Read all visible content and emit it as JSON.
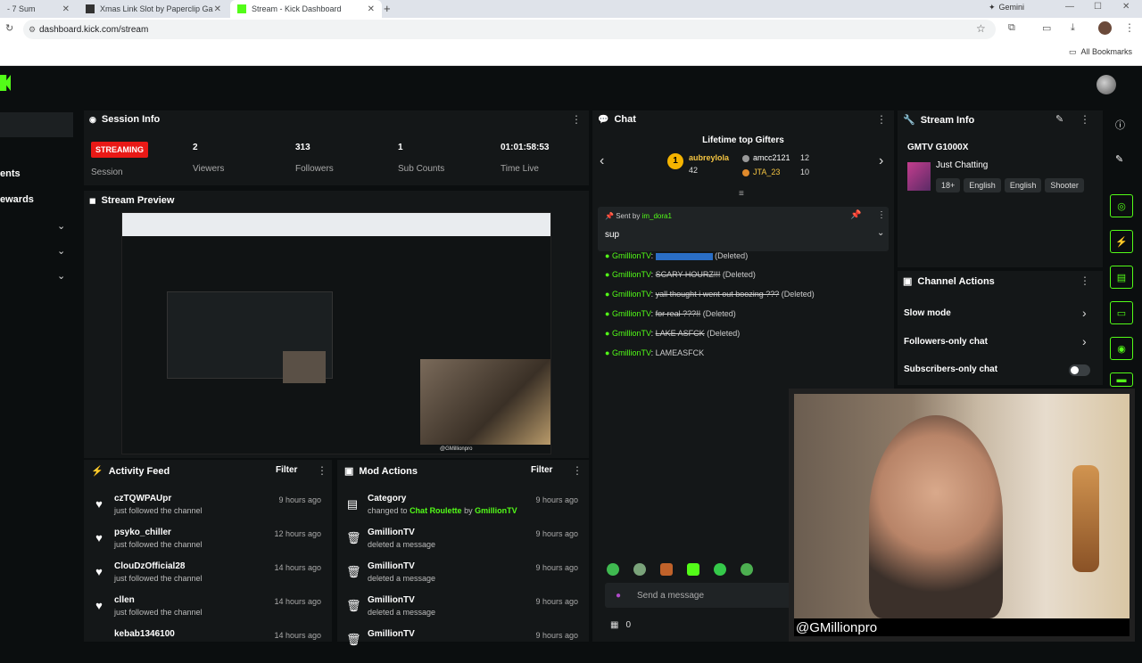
{
  "browser": {
    "tabs": [
      {
        "label": "- 7 Sum"
      },
      {
        "label": "Xmas Link Slot by Paperclip Ga"
      },
      {
        "label": "Stream - Kick Dashboard"
      }
    ],
    "url": "dashboard.kick.com/stream",
    "profile_label": "Gemini",
    "all_bookmarks": "All Bookmarks"
  },
  "sidebar": {
    "items": [
      {
        "label": "ents"
      },
      {
        "label": "ewards"
      }
    ]
  },
  "session_info": {
    "title": "Session Info",
    "status_badge": "STREAMING",
    "status_label": "Session",
    "viewers_value": "2",
    "viewers_label": "Viewers",
    "followers_value": "313",
    "followers_label": "Followers",
    "subs_value": "1",
    "subs_label": "Sub Counts",
    "time_value": "01:01:58:53",
    "time_label": "Time Live"
  },
  "stream_preview": {
    "title": "Stream Preview",
    "watermark": "@GMillionpro"
  },
  "activity_feed": {
    "title": "Activity Feed",
    "filter_label": "Filter",
    "items": [
      {
        "name": "czTQWPAUpr",
        "action": "just followed the channel",
        "time": "9 hours ago"
      },
      {
        "name": "psyko_chiller",
        "action": "just followed the channel",
        "time": "12 hours ago"
      },
      {
        "name": "ClouDzOfficial28",
        "action": "just followed the channel",
        "time": "14 hours ago"
      },
      {
        "name": "cllen",
        "action": "just followed the channel",
        "time": "14 hours ago"
      },
      {
        "name": "kebab1346100",
        "action": "",
        "time": "14 hours ago"
      }
    ]
  },
  "mod_actions": {
    "title": "Mod Actions",
    "filter_label": "Filter",
    "first_item": {
      "name": "Category",
      "prefix": "changed to",
      "value": "Chat Roulette",
      "by": "by",
      "user": "GmillionTV",
      "time": "9 hours ago"
    },
    "items": [
      {
        "name": "GmillionTV",
        "action": "deleted a message",
        "time": "9 hours ago"
      },
      {
        "name": "GmillionTV",
        "action": "deleted a message",
        "time": "9 hours ago"
      },
      {
        "name": "GmillionTV",
        "action": "deleted a message",
        "time": "9 hours ago"
      },
      {
        "name": "GmillionTV",
        "action": "",
        "time": "9 hours ago"
      }
    ]
  },
  "chat": {
    "title": "Chat",
    "gifters_title": "Lifetime top Gifters",
    "gifters": [
      {
        "name": "aubreylola",
        "count": "42",
        "rank": "1"
      },
      {
        "name": "amcc2121",
        "count": "12"
      },
      {
        "name": "JTA_23",
        "count": "10"
      }
    ],
    "pinned": {
      "sent_by": "Sent by",
      "user": "im_dora1",
      "message": "sup"
    },
    "messages": [
      {
        "user": "GmillionTV",
        "text": "",
        "status": "(Deleted)"
      },
      {
        "user": "GmillionTV",
        "text": "SCARY HOURZ!!!",
        "status": "(Deleted)"
      },
      {
        "user": "GmillionTV",
        "text": "yall thought i went out boozing ???",
        "status": "(Deleted)"
      },
      {
        "user": "GmillionTV",
        "text": "for real ???!!",
        "status": "(Deleted)"
      },
      {
        "user": "GmillionTV",
        "text": "LAKE ASFCK",
        "status": "(Deleted)"
      },
      {
        "user": "GmillionTV",
        "text": "LAMEASFCK",
        "status": ""
      }
    ],
    "input_placeholder": "Send a message",
    "bottom_count": "0"
  },
  "stream_info": {
    "title": "Stream Info",
    "stream_title": "GMTV G1000X",
    "category": "Just Chatting",
    "tags": [
      "18+",
      "English",
      "English",
      "Shooter"
    ]
  },
  "channel_actions": {
    "title": "Channel Actions",
    "items": [
      {
        "label": "Slow mode"
      },
      {
        "label": "Followers-only chat"
      },
      {
        "label": "Subscribers-only chat"
      }
    ]
  },
  "webcam": {
    "handle": "@GMillionpro"
  },
  "colors": {
    "accent": "#53fc18",
    "streaming_badge": "#e91916",
    "panel": "#141718",
    "background": "#0b0e0f"
  }
}
